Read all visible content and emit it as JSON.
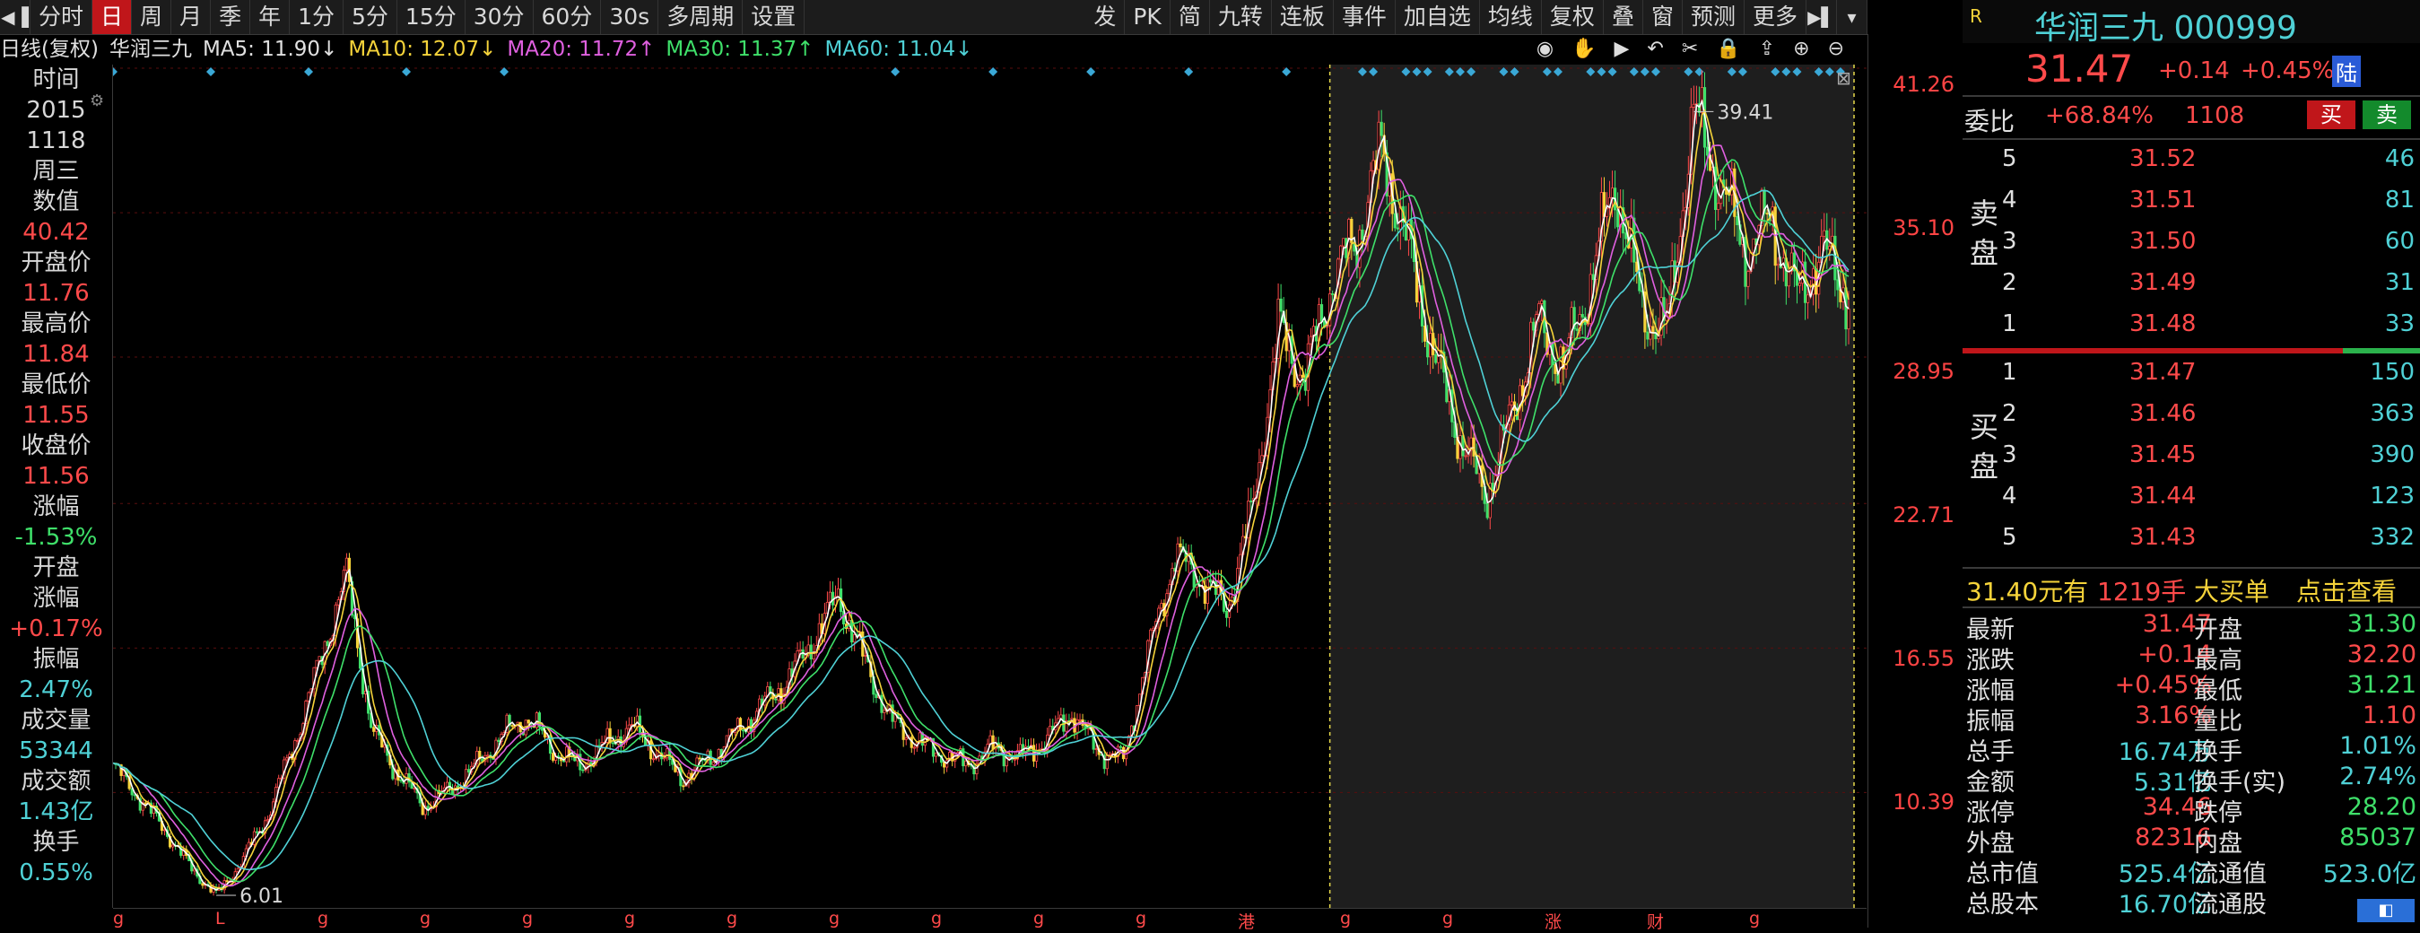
{
  "toolbar": {
    "left_items": [
      "分时",
      "日",
      "周",
      "月",
      "季",
      "年",
      "1分",
      "5分",
      "15分",
      "30分",
      "60分",
      "30s",
      "多周期",
      "设置"
    ],
    "active": "日",
    "right_items": [
      "发",
      "PK",
      "简",
      "九转",
      "连板",
      "事件",
      "加自选",
      "均线",
      "复权",
      "叠",
      "窗",
      "预测",
      "更多"
    ]
  },
  "info": {
    "period": "日线(复权)",
    "name": "华润三九",
    "ma5": "MA5: 11.90↓",
    "ma10": "MA10: 12.07↓",
    "ma20": "MA20: 11.72↑",
    "ma30": "MA30: 11.37↑",
    "ma60": "MA60: 11.04↓"
  },
  "left_panel": [
    {
      "label": "时间",
      "value": "2015"
    },
    {
      "label": "",
      "value": "1118"
    },
    {
      "label": "周三",
      "value": ""
    },
    {
      "label": "数值",
      "value": "40.42",
      "color": "red"
    },
    {
      "label": "开盘价",
      "value": "11.76",
      "color": "red"
    },
    {
      "label": "最高价",
      "value": "11.84",
      "color": "red"
    },
    {
      "label": "最低价",
      "value": "11.55",
      "color": "red"
    },
    {
      "label": "收盘价",
      "value": "11.56",
      "color": "red"
    },
    {
      "label": "涨幅",
      "value": "-1.53%",
      "color": "green"
    },
    {
      "label": "开盘",
      "value": ""
    },
    {
      "label": "涨幅",
      "value": "+0.17%",
      "color": "red"
    },
    {
      "label": "振幅",
      "value": "2.47%"
    },
    {
      "label": "成交量",
      "value": "53344"
    },
    {
      "label": "成交额",
      "value": "1.43亿"
    },
    {
      "label": "换手",
      "value": "0.55%"
    }
  ],
  "axis": {
    "ticks": [
      "41.26",
      "35.10",
      "28.95",
      "22.71",
      "16.55",
      "10.39"
    ]
  },
  "chart_annotations": {
    "high": "39.41",
    "low": "6.01"
  },
  "chart_data": {
    "type": "line",
    "title": "",
    "series": [
      {
        "name": "",
        "values": [
          11.5,
          10.2,
          8.8,
          7.2,
          6.01,
          7.5,
          9.5,
          12.5,
          16.0,
          19.7,
          13.0,
          11.2,
          9.8,
          10.5,
          11.5,
          12.8,
          13.6,
          12.2,
          11.5,
          12.4,
          13.2,
          12.1,
          11.0,
          11.8,
          12.9,
          14.0,
          15.1,
          16.8,
          18.8,
          16.0,
          13.5,
          12.6,
          12.0,
          11.6,
          12.3,
          11.9,
          12.6,
          13.8,
          12.2,
          11.8,
          16.5,
          20.5,
          19.5,
          18.2,
          22.5,
          30.2,
          28.0,
          32.0,
          34.0,
          37.8,
          33.5,
          29.0,
          25.5,
          23.0,
          26.5,
          30.5,
          28.5,
          32.0,
          36.5,
          31.0,
          30.0,
          39.41,
          36.5,
          33.5,
          34.8,
          31.5,
          33.5,
          31.5
        ]
      }
    ],
    "ylim": [
      6.01,
      41.26
    ],
    "yticks": [
      "41.26",
      "35.10",
      "28.95",
      "22.71",
      "16.55",
      "10.39"
    ]
  },
  "quote": {
    "badge": "R",
    "title": "华润三九 000999",
    "price": "31.47",
    "change": "+0.14",
    "change_pct": "+0.45%",
    "market": "陆",
    "weibi_label": "委比",
    "weibi": "+68.84%",
    "weicha": "1108",
    "buy_btn": "买",
    "sell_btn": "卖",
    "sell_label": [
      "卖",
      "盘"
    ],
    "buy_label": [
      "买",
      "盘"
    ],
    "asks": [
      {
        "lvl": "5",
        "price": "31.52",
        "vol": "46"
      },
      {
        "lvl": "4",
        "price": "31.51",
        "vol": "81"
      },
      {
        "lvl": "3",
        "price": "31.50",
        "vol": "60"
      },
      {
        "lvl": "2",
        "price": "31.49",
        "vol": "31"
      },
      {
        "lvl": "1",
        "price": "31.48",
        "vol": "33"
      }
    ],
    "bids": [
      {
        "lvl": "1",
        "price": "31.47",
        "vol": "150"
      },
      {
        "lvl": "2",
        "price": "31.46",
        "vol": "363"
      },
      {
        "lvl": "3",
        "price": "31.45",
        "vol": "390"
      },
      {
        "lvl": "4",
        "price": "31.44",
        "vol": "123"
      },
      {
        "lvl": "5",
        "price": "31.43",
        "vol": "332"
      }
    ],
    "bigorder": {
      "amount": "31.40元有",
      "vol": "1219手",
      "label": "大买单",
      "link": "点击查看"
    },
    "stats": [
      {
        "l1": "最新",
        "v1": "31.47",
        "c1": "red",
        "l2": "开盘",
        "v2": "31.30",
        "c2": "green"
      },
      {
        "l1": "涨跌",
        "v1": "+0.14",
        "c1": "red",
        "l2": "最高",
        "v2": "32.20",
        "c2": "red"
      },
      {
        "l1": "涨幅",
        "v1": "+0.45%",
        "c1": "red",
        "l2": "最低",
        "v2": "31.21",
        "c2": "green"
      },
      {
        "l1": "振幅",
        "v1": "3.16%",
        "c1": "red",
        "l2": "量比",
        "v2": "1.10",
        "c2": "red"
      },
      {
        "l1": "总手",
        "v1": "16.74万",
        "c1": "cyan",
        "l2": "换手",
        "v2": "1.01%",
        "c2": "cyan"
      },
      {
        "l1": "金额",
        "v1": "5.31亿",
        "c1": "cyan",
        "l2": "换手(实)",
        "v2": "2.74%",
        "c2": "cyan"
      },
      {
        "l1": "涨停",
        "v1": "34.46",
        "c1": "red",
        "l2": "跌停",
        "v2": "28.20",
        "c2": "green"
      },
      {
        "l1": "外盘",
        "v1": "82316",
        "c1": "red",
        "l2": "内盘",
        "v2": "85037",
        "c2": "green"
      },
      {
        "l1": "总市值",
        "v1": "525.4亿",
        "c1": "cyan",
        "l2": "流通值",
        "v2": "523.0亿",
        "c2": "cyan"
      },
      {
        "l1": "总股本",
        "v1": "16.70亿",
        "c1": "cyan",
        "l2": "流通股",
        "v2": "",
        "c2": "cyan"
      }
    ]
  },
  "bottom_marks": [
    "g",
    "L",
    "g",
    "g",
    "g",
    "g",
    "g",
    "g",
    "g",
    "g",
    "g",
    "港",
    "g",
    "g",
    "涨",
    "财",
    "g"
  ],
  "colors": {
    "up": "#ff4a4a",
    "down": "#3fe06a",
    "ma5": "#ffffff",
    "ma10": "#f5d33a",
    "ma20": "#e060e0",
    "ma30": "#3fe06a",
    "ma60": "#4fd1d6"
  }
}
